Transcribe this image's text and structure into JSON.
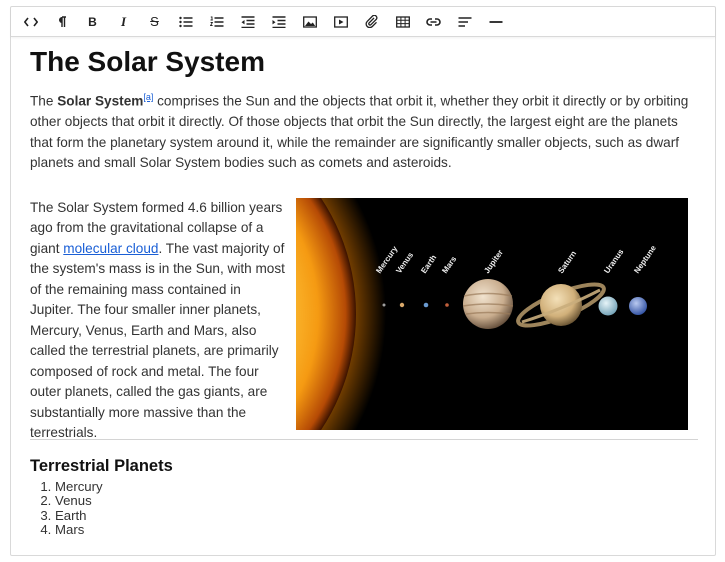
{
  "toolbar": {
    "items": [
      {
        "name": "code-view-button",
        "icon": "code-icon"
      },
      {
        "name": "paragraph-button",
        "icon": "pilcrow-icon"
      },
      {
        "name": "bold-button",
        "label": "B"
      },
      {
        "name": "italic-button",
        "label": "I"
      },
      {
        "name": "strikethrough-button",
        "label": "S"
      },
      {
        "name": "bullet-list-button",
        "icon": "bullet-list-icon"
      },
      {
        "name": "numbered-list-button",
        "icon": "numbered-list-icon"
      },
      {
        "name": "outdent-button",
        "icon": "outdent-icon"
      },
      {
        "name": "indent-button",
        "icon": "indent-icon"
      },
      {
        "name": "image-button",
        "icon": "image-icon"
      },
      {
        "name": "video-button",
        "icon": "video-icon"
      },
      {
        "name": "attachment-button",
        "icon": "paperclip-icon"
      },
      {
        "name": "table-button",
        "icon": "table-icon"
      },
      {
        "name": "link-button",
        "icon": "link-icon"
      },
      {
        "name": "align-button",
        "icon": "align-left-icon"
      },
      {
        "name": "horizontal-rule-button",
        "icon": "horizontal-rule-icon"
      }
    ]
  },
  "document": {
    "title": "The Solar System",
    "intro": {
      "prefix": "The ",
      "bold": "Solar System",
      "footnote": "[a]",
      "rest": " comprises the Sun and the objects that orbit it, whether they orbit it directly or by orbiting other objects that orbit it directly. Of those objects that orbit the Sun directly, the largest eight are the planets that form the planetary system around it, while the remainder are significantly smaller objects, such as dwarf planets and small Solar System bodies such as comets and asteroids."
    },
    "section": {
      "before_link": "The Solar System formed 4.6 billion years ago from the gravitational collapse of a giant ",
      "link": "molecular cloud",
      "after_link": ". The vast majority of the system's mass is in the Sun, with most of the remaining mass contained in Jupiter. The four smaller inner planets, Mercury, Venus, Earth and Mars, also called the terrestrial planets, are primarily composed of rock and metal. The four outer planets, called the gas giants, are substantially more massive than the terrestrials."
    },
    "figure": {
      "labels": [
        "Mercury",
        "Venus",
        "Earth",
        "Mars",
        "Jupiter",
        "Saturn",
        "Uranus",
        "Neptune"
      ]
    },
    "subheading": "Terrestrial Planets",
    "planets": [
      "Mercury",
      "Venus",
      "Earth",
      "Mars"
    ]
  }
}
